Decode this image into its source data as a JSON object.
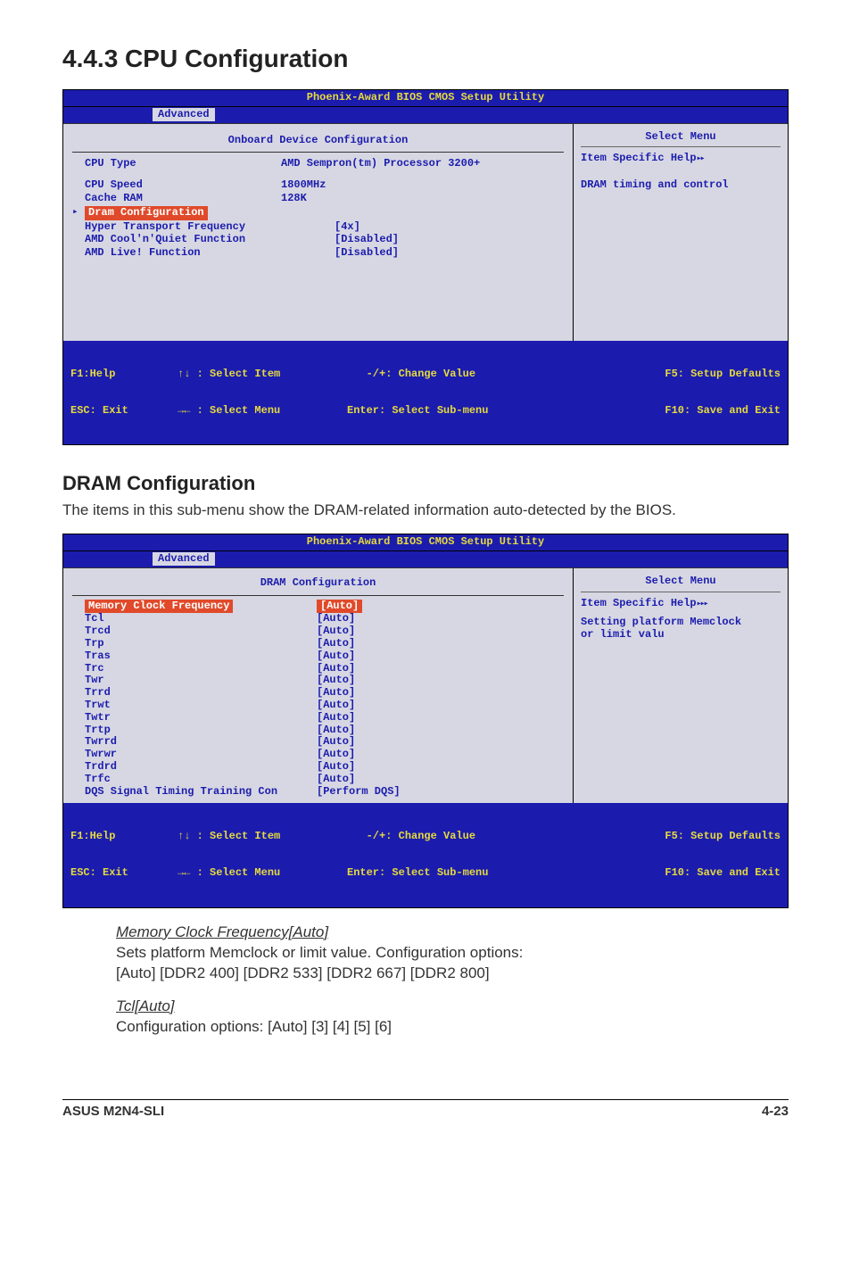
{
  "heading": "4.4.3   CPU Configuration",
  "bios1": {
    "title": "Phoenix-Award BIOS CMOS Setup Utility",
    "tab": "Advanced",
    "panel_title": "Onboard Device Configuration",
    "rows": {
      "cpu_type_label": "CPU Type",
      "cpu_type_val": "AMD Sempron(tm) Processor 3200+",
      "cpu_speed_label": "CPU Speed",
      "cpu_speed_val": "1800MHz",
      "cache_label": "Cache RAM",
      "cache_val": "128K",
      "dram_label": "Dram Configuration",
      "hyper_label": "Hyper Transport Frequency",
      "hyper_val": "[4x]",
      "cnq_label": "AMD Cool'n'Quiet Function",
      "cnq_val": "[Disabled]",
      "live_label": "AMD Live! Function",
      "live_val": "[Disabled]"
    },
    "right": {
      "select_menu": "Select Menu",
      "help": "Item Specific Help",
      "help_body": "DRAM timing and control"
    },
    "footer": {
      "f1": "F1:Help",
      "esc": "ESC: Exit",
      "sel_item": ": Select Item",
      "sel_menu": ": Select Menu",
      "change": "-/+: Change Value",
      "enter": "Enter: Select Sub-menu",
      "f5": "F5: Setup Defaults",
      "f10": "F10: Save and Exit"
    }
  },
  "sub_heading": "DRAM Configuration",
  "sub_body": "The items in this sub-menu show the DRAM-related information auto-detected by the BIOS.",
  "bios2": {
    "title": "Phoenix-Award BIOS CMOS Setup Utility",
    "tab": "Advanced",
    "panel_title": "DRAM Configuration",
    "highlight_label": "Memory Clock Frequency",
    "highlight_val": "[Auto]",
    "rows": [
      {
        "label": "Tcl",
        "val": "[Auto]"
      },
      {
        "label": "Trcd",
        "val": "[Auto]"
      },
      {
        "label": "Trp",
        "val": "[Auto]"
      },
      {
        "label": "Tras",
        "val": "[Auto]"
      },
      {
        "label": "Trc",
        "val": "[Auto]"
      },
      {
        "label": "Twr",
        "val": "[Auto]"
      },
      {
        "label": "Trrd",
        "val": "[Auto]"
      },
      {
        "label": "Trwt",
        "val": "[Auto]"
      },
      {
        "label": "Twtr",
        "val": "[Auto]"
      },
      {
        "label": "Trtp",
        "val": "[Auto]"
      },
      {
        "label": "Twrrd",
        "val": "[Auto]"
      },
      {
        "label": "Twrwr",
        "val": "[Auto]"
      },
      {
        "label": "Trdrd",
        "val": "[Auto]"
      },
      {
        "label": "Trfc",
        "val": "[Auto]"
      },
      {
        "label": "DQS Signal Timing Training Con",
        "val": "[Perform DQS]"
      }
    ],
    "right": {
      "select_menu": "Select Menu",
      "help": "Item Specific Help",
      "help_body1": "Setting platform Memclock",
      "help_body2": "or limit valu"
    },
    "footer": {
      "f1": "F1:Help",
      "esc": "ESC: Exit",
      "sel_item": ": Select Item",
      "sel_menu": ": Select Menu",
      "change": "-/+: Change Value",
      "enter": "Enter: Select Sub-menu",
      "f5": "F5: Setup Defaults",
      "f10": "F10: Save and Exit"
    }
  },
  "defs": {
    "mem_term": "Memory Clock Frequency[Auto]",
    "mem_body1": "Sets platform Memclock or limit value. Configuration options:",
    "mem_body2": "[Auto] [DDR2 400] [DDR2 533] [DDR2 667] [DDR2 800]",
    "tcl_term": "Tcl[Auto]",
    "tcl_body": "Configuration options: [Auto] [3] [4] [5] [6]"
  },
  "footer": {
    "left": "ASUS M2N4-SLI",
    "right": "4-23"
  }
}
